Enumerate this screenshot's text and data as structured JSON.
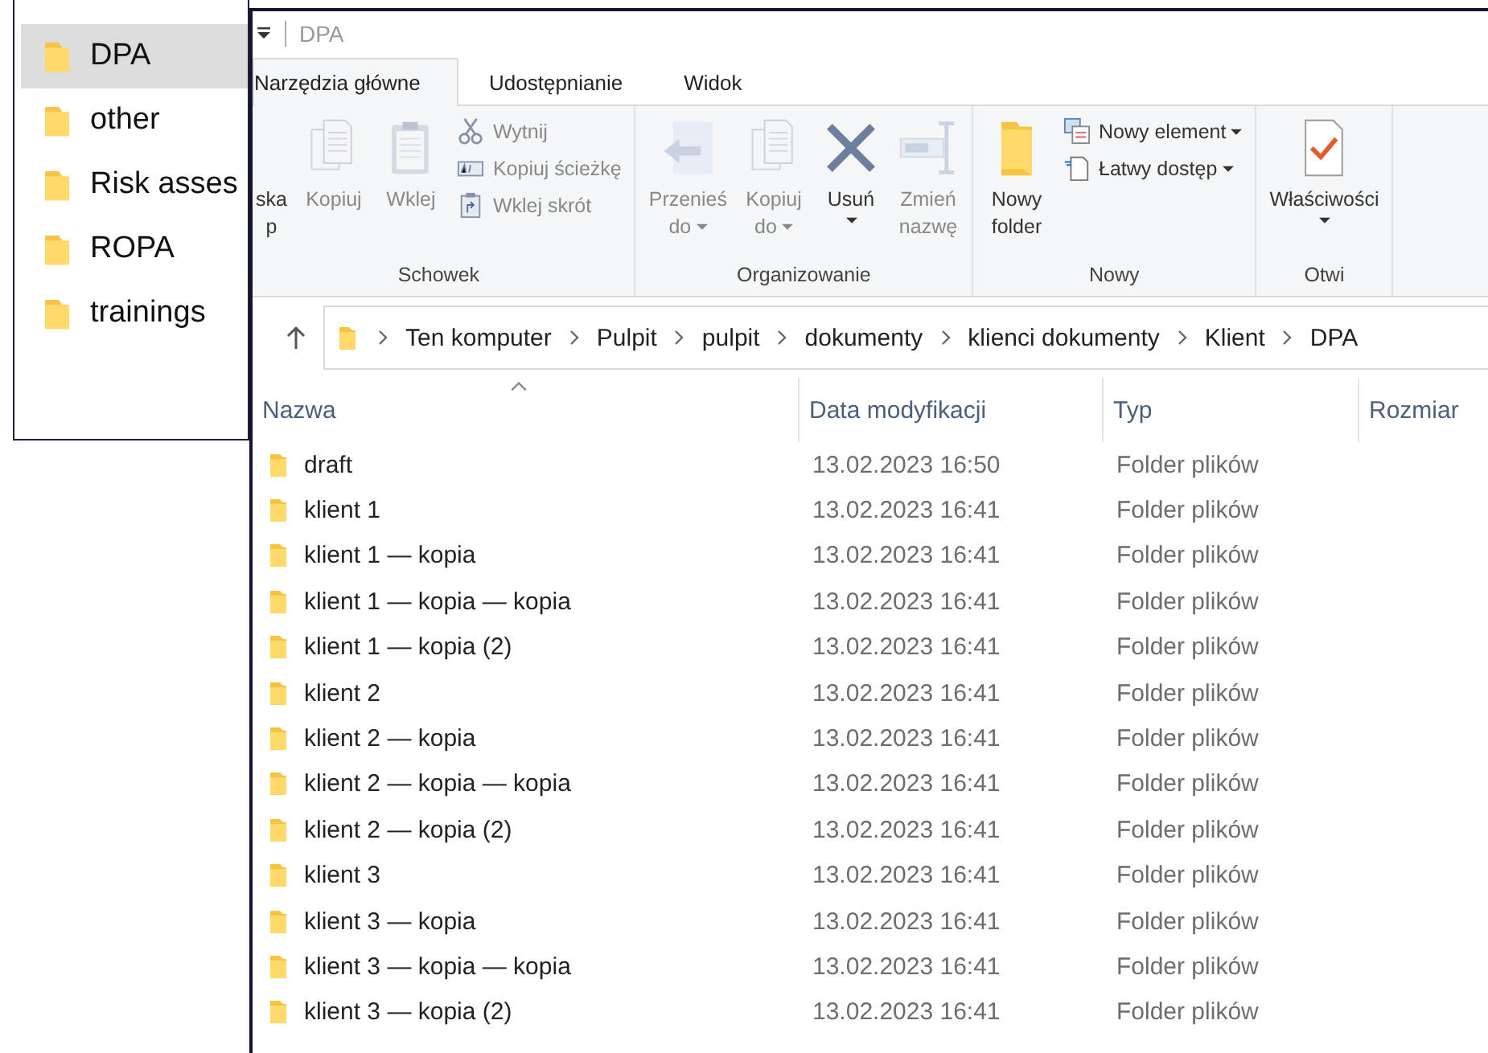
{
  "back_panel": {
    "items": [
      {
        "name": "DPA",
        "selected": true
      },
      {
        "name": "other",
        "selected": false
      },
      {
        "name": "Risk asses",
        "selected": false
      },
      {
        "name": "ROPA",
        "selected": false
      },
      {
        "name": "trainings",
        "selected": false
      }
    ]
  },
  "window": {
    "title": "DPA"
  },
  "tabs": [
    {
      "label": "Narzędzia główne",
      "selected": true
    },
    {
      "label": "Udostępnianie",
      "selected": false
    },
    {
      "label": "Widok",
      "selected": false
    }
  ],
  "ribbon": {
    "groups": [
      {
        "label": "Schowek",
        "items": [
          {
            "kind": "large",
            "label": "ska p",
            "disabled": false
          },
          {
            "kind": "large",
            "label": "Kopiuj",
            "disabled": true
          },
          {
            "kind": "large",
            "label": "Wklej",
            "disabled": true
          },
          {
            "kind": "stack",
            "items": [
              {
                "label": "Wytnij",
                "disabled": true
              },
              {
                "label": "Kopiuj ścieżkę",
                "disabled": true
              },
              {
                "label": "Wklej skrót",
                "disabled": true
              }
            ]
          }
        ]
      },
      {
        "label": "Organizowanie",
        "items": [
          {
            "kind": "large",
            "label": "Przenieś do",
            "disabled": true,
            "dropdown": true
          },
          {
            "kind": "large",
            "label": "Kopiuj do",
            "disabled": true,
            "dropdown": true
          },
          {
            "kind": "split",
            "label": "Usuń",
            "disabled": false
          },
          {
            "kind": "large",
            "label": "Zmień nazwę",
            "disabled": true
          }
        ]
      },
      {
        "label": "Nowy",
        "items": [
          {
            "kind": "large",
            "label": "Nowy folder",
            "disabled": false
          },
          {
            "kind": "stack",
            "items": [
              {
                "label": "Nowy element",
                "disabled": false,
                "dropdown": true
              },
              {
                "label": "Łatwy dostęp",
                "disabled": false,
                "dropdown": true
              }
            ]
          }
        ]
      },
      {
        "label": "Otwi",
        "items": [
          {
            "kind": "split",
            "label": "Właściwości",
            "disabled": false
          }
        ]
      }
    ]
  },
  "address": {
    "path": [
      "Ten komputer",
      "Pulpit",
      "pulpit",
      "dokumenty",
      "klienci dokumenty",
      "Klient",
      "DPA"
    ]
  },
  "table": {
    "columns": [
      "Nazwa",
      "Data modyfikacji",
      "Typ",
      "Rozmiar"
    ],
    "rows": [
      {
        "name": "draft",
        "modified": "13.02.2023 16:50",
        "type": "Folder plików"
      },
      {
        "name": "klient 1",
        "modified": "13.02.2023 16:41",
        "type": "Folder plików"
      },
      {
        "name": "klient 1 — kopia",
        "modified": "13.02.2023 16:41",
        "type": "Folder plików"
      },
      {
        "name": "klient 1 — kopia — kopia",
        "modified": "13.02.2023 16:41",
        "type": "Folder plików"
      },
      {
        "name": "klient 1 — kopia (2)",
        "modified": "13.02.2023 16:41",
        "type": "Folder plików"
      },
      {
        "name": "klient 2",
        "modified": "13.02.2023 16:41",
        "type": "Folder plików"
      },
      {
        "name": "klient 2 — kopia",
        "modified": "13.02.2023 16:41",
        "type": "Folder plików"
      },
      {
        "name": "klient 2 — kopia — kopia",
        "modified": "13.02.2023 16:41",
        "type": "Folder plików"
      },
      {
        "name": "klient 2 — kopia (2)",
        "modified": "13.02.2023 16:41",
        "type": "Folder plików"
      },
      {
        "name": "klient 3",
        "modified": "13.02.2023 16:41",
        "type": "Folder plików"
      },
      {
        "name": "klient 3 — kopia",
        "modified": "13.02.2023 16:41",
        "type": "Folder plików"
      },
      {
        "name": "klient 3 — kopia — kopia",
        "modified": "13.02.2023 16:41",
        "type": "Folder plików"
      },
      {
        "name": "klient 3 — kopia (2)",
        "modified": "13.02.2023 16:41",
        "type": "Folder plików"
      }
    ]
  }
}
